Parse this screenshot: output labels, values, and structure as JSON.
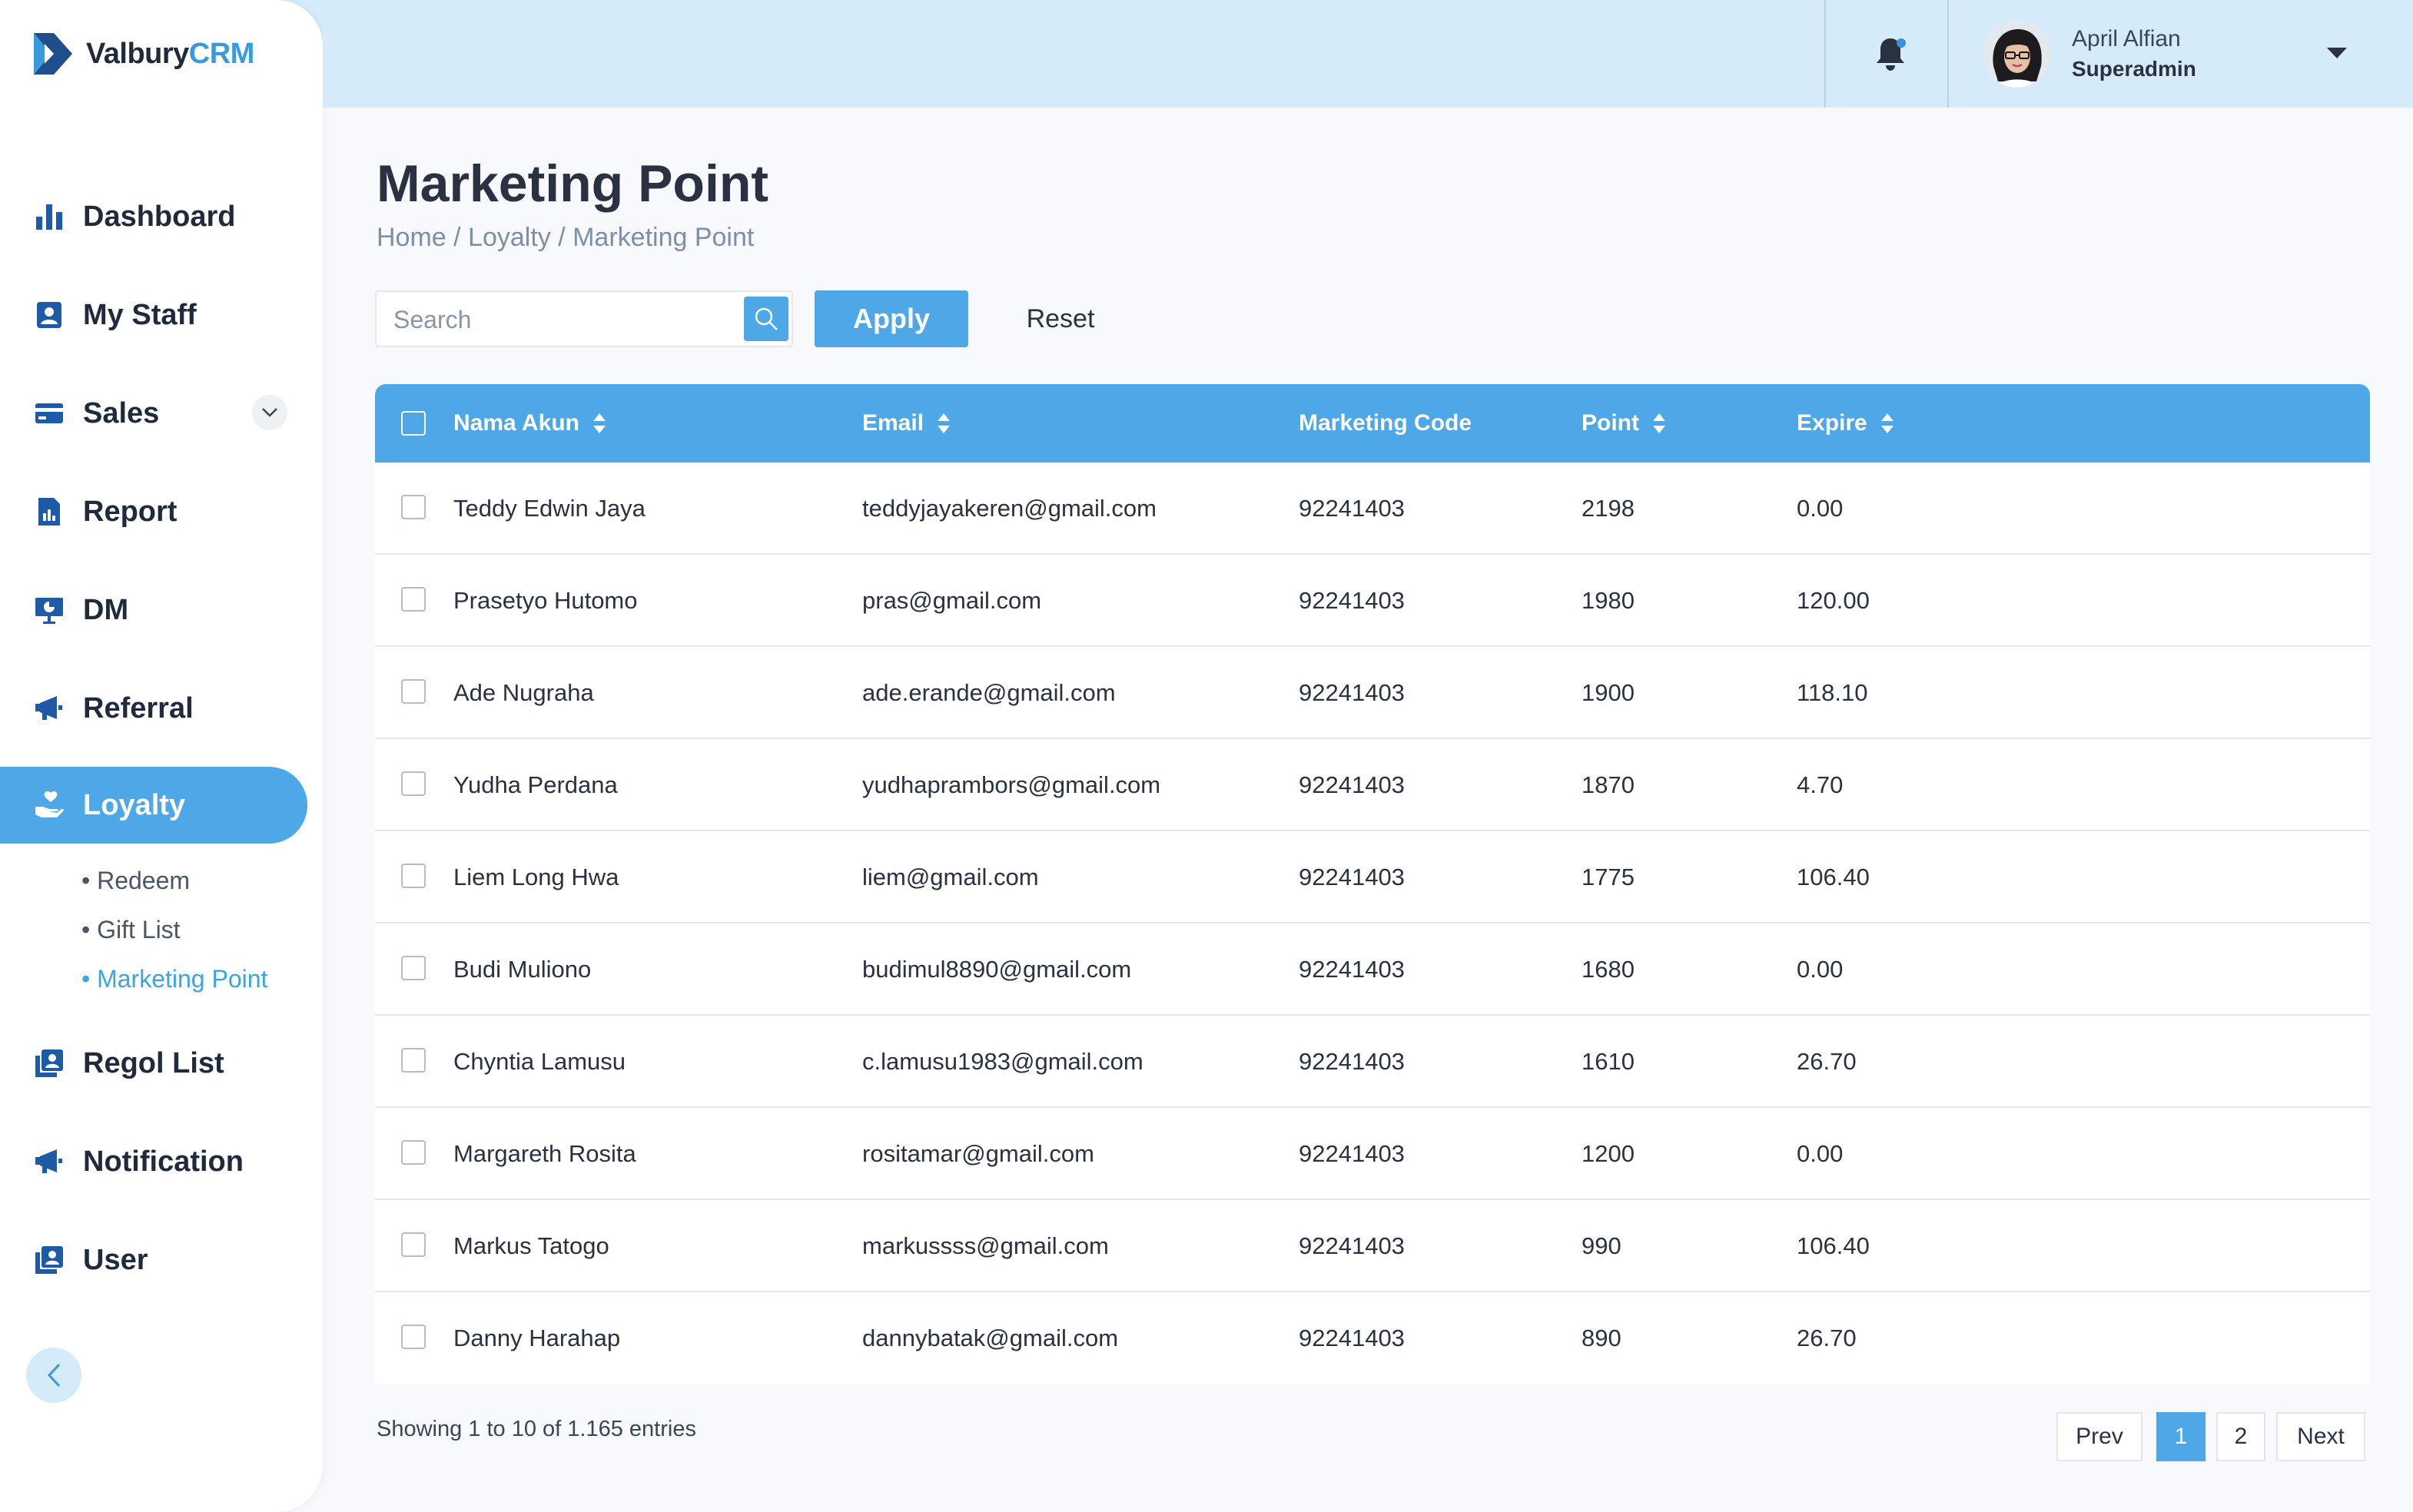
{
  "app": {
    "logo_prefix": "Valbury",
    "logo_suffix": "CRM"
  },
  "user": {
    "name": "April Alfian",
    "role": "Superadmin"
  },
  "sidebar": {
    "items": [
      {
        "label": "Dashboard",
        "icon": "bar-chart-icon"
      },
      {
        "label": "My Staff",
        "icon": "badge-icon"
      },
      {
        "label": "Sales",
        "icon": "credit-card-icon"
      },
      {
        "label": "Report",
        "icon": "report-icon"
      },
      {
        "label": "DM",
        "icon": "presentation-icon"
      },
      {
        "label": "Referral",
        "icon": "megaphone-icon"
      },
      {
        "label": "Loyalty",
        "icon": "hand-heart-icon"
      },
      {
        "label": "Regol List",
        "icon": "contacts-icon"
      },
      {
        "label": "Notification",
        "icon": "megaphone-icon"
      },
      {
        "label": "User",
        "icon": "contacts-icon"
      }
    ],
    "loyalty_sub": [
      "• Redeem",
      "• Gift List",
      "• Marketing Point"
    ]
  },
  "page": {
    "title": "Marketing Point",
    "breadcrumb": "Home / Loyalty / Marketing Point"
  },
  "filters": {
    "search_placeholder": "Search",
    "search_value": "",
    "apply_label": "Apply",
    "reset_label": "Reset"
  },
  "table": {
    "columns": [
      "Nama Akun",
      "Email",
      "Marketing Code",
      "Point",
      "Expire"
    ],
    "rows": [
      {
        "name": "Teddy Edwin Jaya",
        "email": "teddyjayakeren@gmail.com",
        "code": "92241403",
        "point": "2198",
        "expire": "0.00"
      },
      {
        "name": "Prasetyo Hutomo",
        "email": "pras@gmail.com",
        "code": "92241403",
        "point": "1980",
        "expire": "120.00"
      },
      {
        "name": "Ade Nugraha",
        "email": "ade.erande@gmail.com",
        "code": "92241403",
        "point": "1900",
        "expire": "118.10"
      },
      {
        "name": "Yudha Perdana",
        "email": "yudhaprambors@gmail.com",
        "code": "92241403",
        "point": "1870",
        "expire": "4.70"
      },
      {
        "name": "Liem Long Hwa",
        "email": "liem@gmail.com",
        "code": "92241403",
        "point": "1775",
        "expire": "106.40"
      },
      {
        "name": "Budi Muliono",
        "email": "budimul8890@gmail.com",
        "code": "92241403",
        "point": "1680",
        "expire": "0.00"
      },
      {
        "name": "Chyntia Lamusu",
        "email": "c.lamusu1983@gmail.com",
        "code": "92241403",
        "point": "1610",
        "expire": "26.70"
      },
      {
        "name": "Margareth Rosita",
        "email": "rositamar@gmail.com",
        "code": "92241403",
        "point": "1200",
        "expire": "0.00"
      },
      {
        "name": "Markus Tatogo",
        "email": "markussss@gmail.com",
        "code": "92241403",
        "point": "990",
        "expire": "106.40"
      },
      {
        "name": "Danny Harahap",
        "email": "dannybatak@gmail.com",
        "code": "92241403",
        "point": "890",
        "expire": "26.70"
      }
    ]
  },
  "pagination": {
    "info": "Showing 1 to 10 of 1.165 entries",
    "prev": "Prev",
    "pages": [
      "1",
      "2"
    ],
    "next": "Next"
  },
  "colors": {
    "accent": "#4ea8e8",
    "topbar": "#d5ebfa"
  }
}
